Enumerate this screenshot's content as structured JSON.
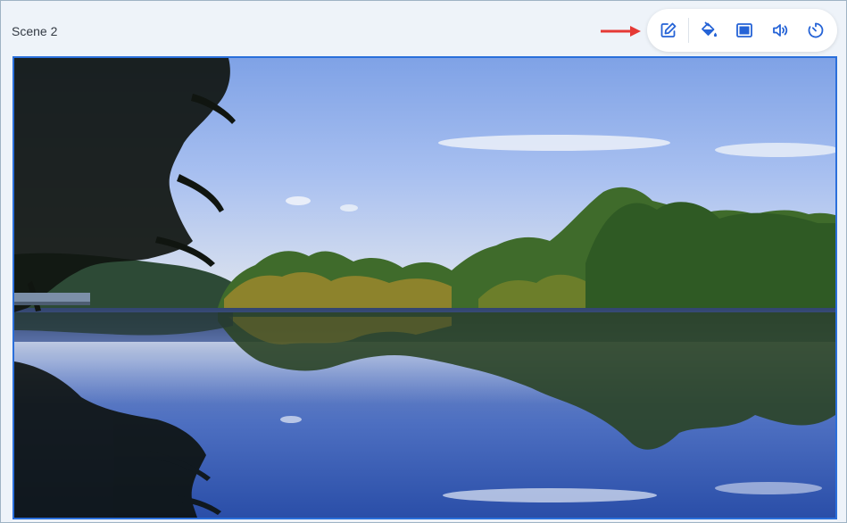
{
  "scene": {
    "title": "Scene 2"
  },
  "toolbar": {
    "icons": [
      "edit-icon",
      "paint-bucket-icon",
      "background-frame-icon",
      "volume-icon",
      "timer-icon"
    ],
    "accent_color": "#2563d6"
  },
  "annotation": {
    "arrow_color": "#e53935"
  },
  "selection_border_color": "#2a6fdb"
}
